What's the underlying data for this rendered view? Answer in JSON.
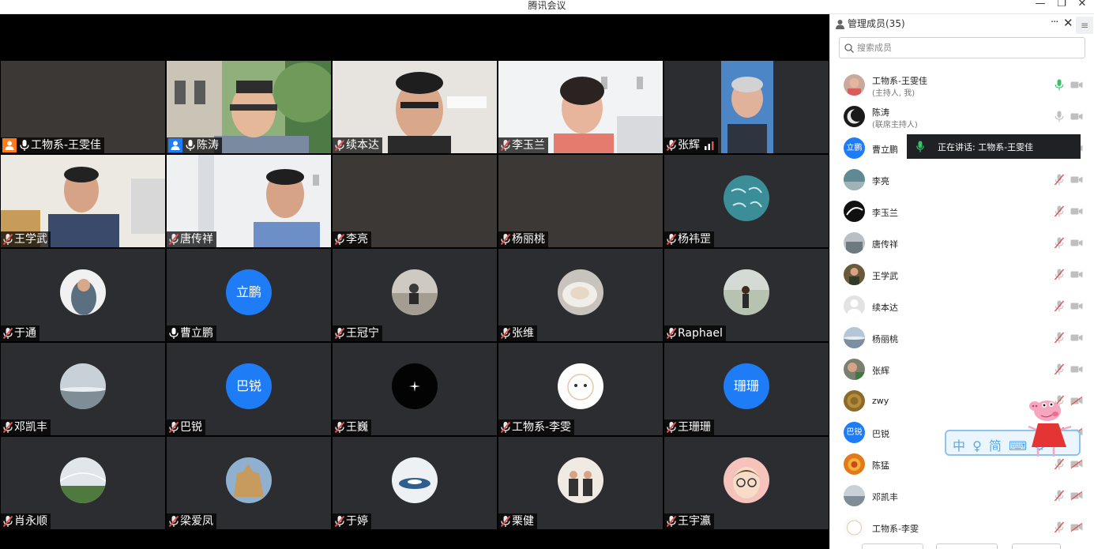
{
  "window": {
    "title": "腾讯会议",
    "minimize": "—",
    "restore": "❐",
    "close": "✕"
  },
  "colors": {
    "tile_bg": "#2b2d30",
    "active_speaker_border": "#38c06a",
    "host_badge": "#ff7a1a",
    "cohost_badge": "#1e7cf6",
    "avatar_blue": "#1e7cf6",
    "muted_mic": "#e0524e",
    "talking_mic": "#38c06a"
  },
  "grid": {
    "tiles": [
      {
        "name": "工物系-王雯佳",
        "mic": "on",
        "badge": "host"
      },
      {
        "name": "陈涛",
        "mic": "on",
        "badge": "cohost"
      },
      {
        "name": "续本达",
        "mic": "muted"
      },
      {
        "name": "李玉兰",
        "mic": "muted"
      },
      {
        "name": "张辉",
        "mic": "muted",
        "signal": true
      },
      {
        "name": "王学武",
        "mic": "muted"
      },
      {
        "name": "唐传祥",
        "mic": "muted"
      },
      {
        "name": "李亮",
        "mic": "muted"
      },
      {
        "name": "杨丽桃",
        "mic": "muted"
      },
      {
        "name": "杨祎罡",
        "mic": "muted"
      },
      {
        "name": "于通",
        "mic": "muted"
      },
      {
        "name": "曹立鹏",
        "mic": "on",
        "avatar_text": "立鹏"
      },
      {
        "name": "王冠宁",
        "mic": "muted"
      },
      {
        "name": "张维",
        "mic": "muted"
      },
      {
        "name": "Raphael",
        "mic": "muted"
      },
      {
        "name": "邓凯丰",
        "mic": "muted"
      },
      {
        "name": "巴锐",
        "mic": "muted",
        "avatar_text": "巴锐"
      },
      {
        "name": "王巍",
        "mic": "muted"
      },
      {
        "name": "工物系-李雯",
        "mic": "muted"
      },
      {
        "name": "王珊珊",
        "mic": "muted",
        "avatar_text": "珊珊"
      },
      {
        "name": "肖永顺",
        "mic": "muted"
      },
      {
        "name": "梁爱凤",
        "mic": "muted"
      },
      {
        "name": "于婷",
        "mic": "muted"
      },
      {
        "name": "栗健",
        "mic": "muted"
      },
      {
        "name": "王宇瀛",
        "mic": "muted"
      }
    ]
  },
  "panel": {
    "title": "管理成员(35)",
    "more_icon": "···",
    "close_icon": "✕",
    "side_icon": "≡",
    "search_placeholder": "搜索成员",
    "members": [
      {
        "name": "工物系-王雯佳",
        "role": "(主持人, 我)",
        "mic": "talking",
        "cam": "off"
      },
      {
        "name": "陈涛",
        "role": "(联席主持人)",
        "mic": "on",
        "cam": "off"
      },
      {
        "name": "曹立鹏",
        "mic": "on",
        "cam": "off",
        "avatar_text": "立鹏"
      },
      {
        "name": "李亮",
        "mic": "muted",
        "cam": "off"
      },
      {
        "name": "李玉兰",
        "mic": "muted",
        "cam": "off"
      },
      {
        "name": "唐传祥",
        "mic": "muted",
        "cam": "off"
      },
      {
        "name": "王学武",
        "mic": "muted",
        "cam": "off"
      },
      {
        "name": "续本达",
        "mic": "muted",
        "cam": "off"
      },
      {
        "name": "杨丽桃",
        "mic": "muted",
        "cam": "off"
      },
      {
        "name": "张辉",
        "mic": "muted",
        "cam": "off"
      },
      {
        "name": "zwy",
        "mic": "muted",
        "cam": "muted"
      },
      {
        "name": "巴锐",
        "mic": "muted",
        "cam": "muted",
        "avatar_text": "巴锐"
      },
      {
        "name": "陈猛",
        "mic": "muted",
        "cam": "muted"
      },
      {
        "name": "邓凯丰",
        "mic": "muted",
        "cam": "muted"
      },
      {
        "name": "工物系-李雯",
        "mic": "muted",
        "cam": "muted"
      }
    ]
  },
  "speaking_tooltip": {
    "text": "正在讲话: 工物系-王雯佳"
  },
  "ime_bar": {
    "text": "中 ♀ 简 ⌨ ⚙"
  }
}
